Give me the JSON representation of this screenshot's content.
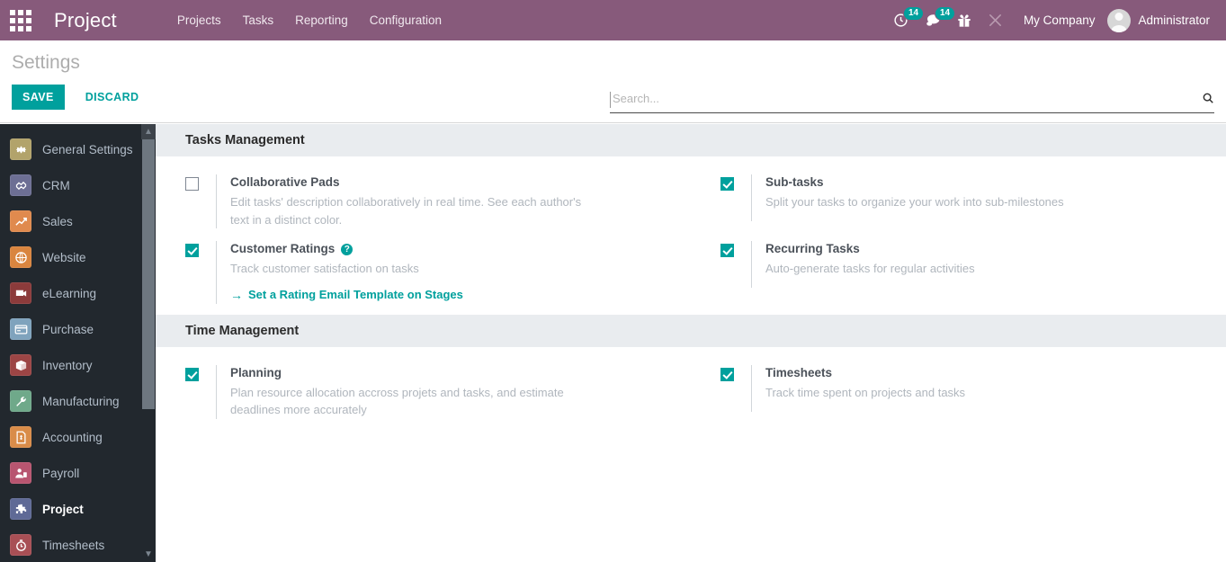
{
  "navbar": {
    "apps_icon": "apps-grid-icon",
    "brand": "Project",
    "menu": [
      {
        "label": "Projects"
      },
      {
        "label": "Tasks"
      },
      {
        "label": "Reporting"
      },
      {
        "label": "Configuration"
      }
    ],
    "icons": [
      {
        "name": "activities-clock-icon",
        "badge": "14"
      },
      {
        "name": "messages-chat-icon",
        "badge": "14"
      },
      {
        "name": "gift-icon",
        "badge": ""
      },
      {
        "name": "developer-tools-icon",
        "badge": ""
      }
    ],
    "company": "My Company",
    "user": "Administrator",
    "accent": "#875A7B",
    "badge_color": "#00A09D"
  },
  "control_panel": {
    "title": "Settings",
    "save_label": "SAVE",
    "discard_label": "DISCARD",
    "search_placeholder": "Search...",
    "search_value": "",
    "search_icon": "search-icon",
    "primary_color": "#00A09D"
  },
  "sidebar": {
    "items": [
      {
        "label": "General Settings",
        "icon": "gear-icon",
        "color": "#b2a36b",
        "active": false
      },
      {
        "label": "CRM",
        "icon": "crm-handshake-icon",
        "color": "#6d6f94",
        "active": false
      },
      {
        "label": "Sales",
        "icon": "sales-chart-icon",
        "color": "#e08a4e",
        "active": false
      },
      {
        "label": "Website",
        "icon": "globe-icon",
        "color": "#d9853f",
        "active": false
      },
      {
        "label": "eLearning",
        "icon": "elearning-icon",
        "color": "#8c3b3b",
        "active": false
      },
      {
        "label": "Purchase",
        "icon": "purchase-card-icon",
        "color": "#7fa3bd",
        "active": false
      },
      {
        "label": "Inventory",
        "icon": "inventory-box-icon",
        "color": "#9c4545",
        "active": false
      },
      {
        "label": "Manufacturing",
        "icon": "wrench-icon",
        "color": "#6fa98a",
        "active": false
      },
      {
        "label": "Accounting",
        "icon": "invoice-icon",
        "color": "#d98c49",
        "active": false
      },
      {
        "label": "Payroll",
        "icon": "payroll-user-icon",
        "color": "#b85570",
        "active": false
      },
      {
        "label": "Project",
        "icon": "puzzle-icon",
        "color": "#5f6a96",
        "active": true
      },
      {
        "label": "Timesheets",
        "icon": "stopwatch-icon",
        "color": "#a84f55",
        "active": false
      }
    ],
    "scroll_up_icon": "chevron-up-icon",
    "scroll_down_icon": "chevron-down-icon",
    "background": "#22282e"
  },
  "settings": {
    "sections": [
      {
        "heading": "Tasks Management",
        "items": [
          {
            "title": "Collaborative Pads",
            "desc": "Edit tasks' description collaboratively in real time. See each author's text in a distinct color.",
            "checked": false,
            "help": false,
            "link": ""
          },
          {
            "title": "Sub-tasks",
            "desc": "Split your tasks to organize your work into sub-milestones",
            "checked": true,
            "help": false,
            "link": ""
          },
          {
            "title": "Customer Ratings",
            "desc": "Track customer satisfaction on tasks",
            "checked": true,
            "help": true,
            "help_glyph": "?",
            "link": "Set a Rating Email Template on Stages",
            "link_arrow": "→"
          },
          {
            "title": "Recurring Tasks",
            "desc": "Auto-generate tasks for regular activities",
            "checked": true,
            "help": false,
            "link": ""
          }
        ]
      },
      {
        "heading": "Time Management",
        "items": [
          {
            "title": "Planning",
            "desc": "Plan resource allocation accross projets and tasks, and estimate deadlines more accurately",
            "checked": true,
            "help": false,
            "link": ""
          },
          {
            "title": "Timesheets",
            "desc": "Track time spent on projects and tasks",
            "checked": true,
            "help": false,
            "link": ""
          }
        ]
      }
    ]
  }
}
